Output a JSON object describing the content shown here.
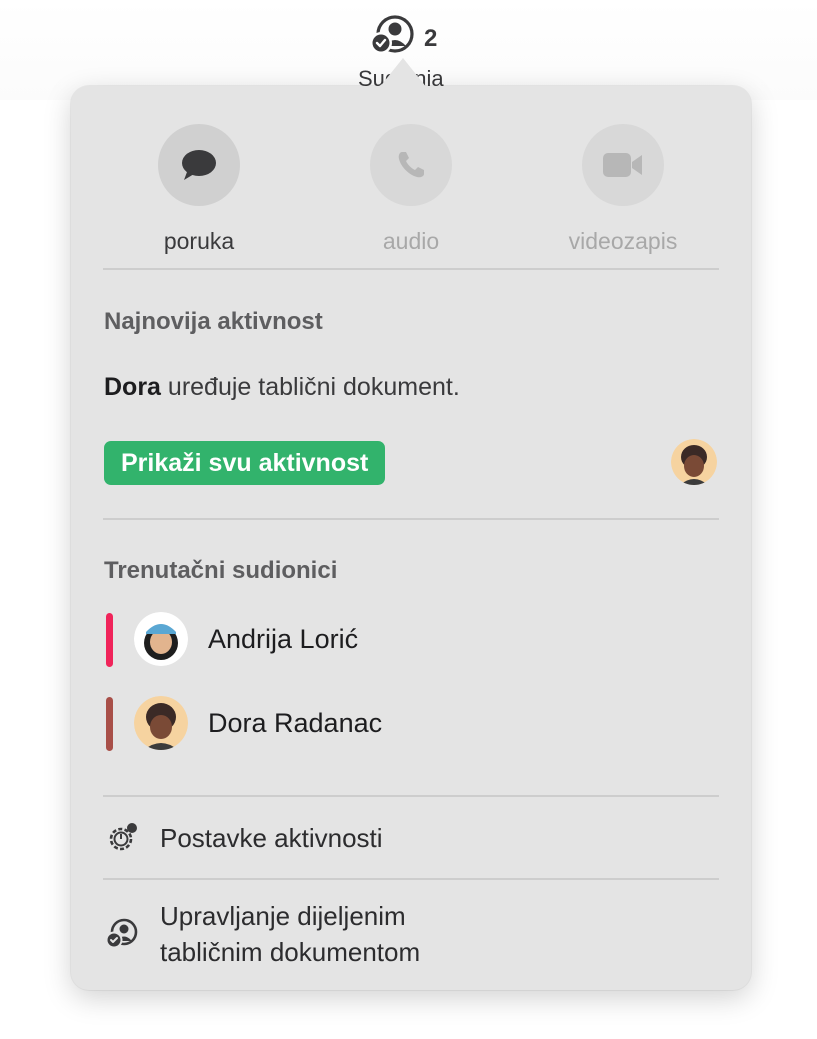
{
  "toolbar": {
    "collab_count": "2",
    "collab_label": "Sudionia"
  },
  "communication": {
    "message": {
      "label": "poruka",
      "icon": "speech-bubble-icon"
    },
    "audio": {
      "label": "audio",
      "icon": "phone-icon"
    },
    "video": {
      "label": "videozapis",
      "icon": "video-camera-icon"
    }
  },
  "recent_activity": {
    "title": "Najnovija aktivnost",
    "actor": "Dora",
    "action": "uređuje tablični dokument.",
    "show_all_label": "Prikaži svu aktivnost"
  },
  "participants": {
    "title": "Trenutačni sudionici",
    "items": [
      {
        "name": "Andrija Lorić",
        "color": "#f0245a"
      },
      {
        "name": "Dora Radanac",
        "color": "#a84f48"
      }
    ]
  },
  "menu": {
    "activity_settings": "Postavke aktivnosti",
    "manage_line1": "Upravljanje dijeljenim",
    "manage_line2": "tabličnim dokumentom"
  },
  "colors": {
    "accent_green": "#32b36c",
    "popover_bg": "#e4e4e4"
  }
}
